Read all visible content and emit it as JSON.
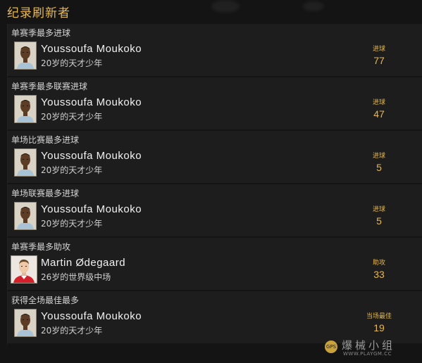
{
  "header": {
    "title": "纪录刷新者"
  },
  "records": [
    {
      "title": "单赛季最多进球",
      "player": "Youssoufa Moukoko",
      "desc": "20岁的天才少年",
      "stat_label": "进球",
      "stat_value": "77",
      "avatar": "moukoko"
    },
    {
      "title": "单赛季最多联赛进球",
      "player": "Youssoufa Moukoko",
      "desc": "20岁的天才少年",
      "stat_label": "进球",
      "stat_value": "47",
      "avatar": "moukoko"
    },
    {
      "title": "单场比赛最多进球",
      "player": "Youssoufa Moukoko",
      "desc": "20岁的天才少年",
      "stat_label": "进球",
      "stat_value": "5",
      "avatar": "moukoko"
    },
    {
      "title": "单场联赛最多进球",
      "player": "Youssoufa Moukoko",
      "desc": "20岁的天才少年",
      "stat_label": "进球",
      "stat_value": "5",
      "avatar": "moukoko"
    },
    {
      "title": "单赛季最多助攻",
      "player": "Martin Ødegaard",
      "desc": "26岁的世界级中场",
      "stat_label": "助攻",
      "stat_value": "33",
      "avatar": "odegaard"
    },
    {
      "title": "获得全场最佳最多",
      "player": "Youssoufa Moukoko",
      "desc": "20岁的天才少年",
      "stat_label": "当场最佳",
      "stat_value": "19",
      "avatar": "moukoko"
    }
  ],
  "watermark": {
    "text": "爆械小组",
    "url": "WWW.PLAYGM.CC",
    "badge": "GPS"
  },
  "colors": {
    "accent": "#e7b84a",
    "background": "#141414",
    "panel": "#1d1d1d"
  }
}
